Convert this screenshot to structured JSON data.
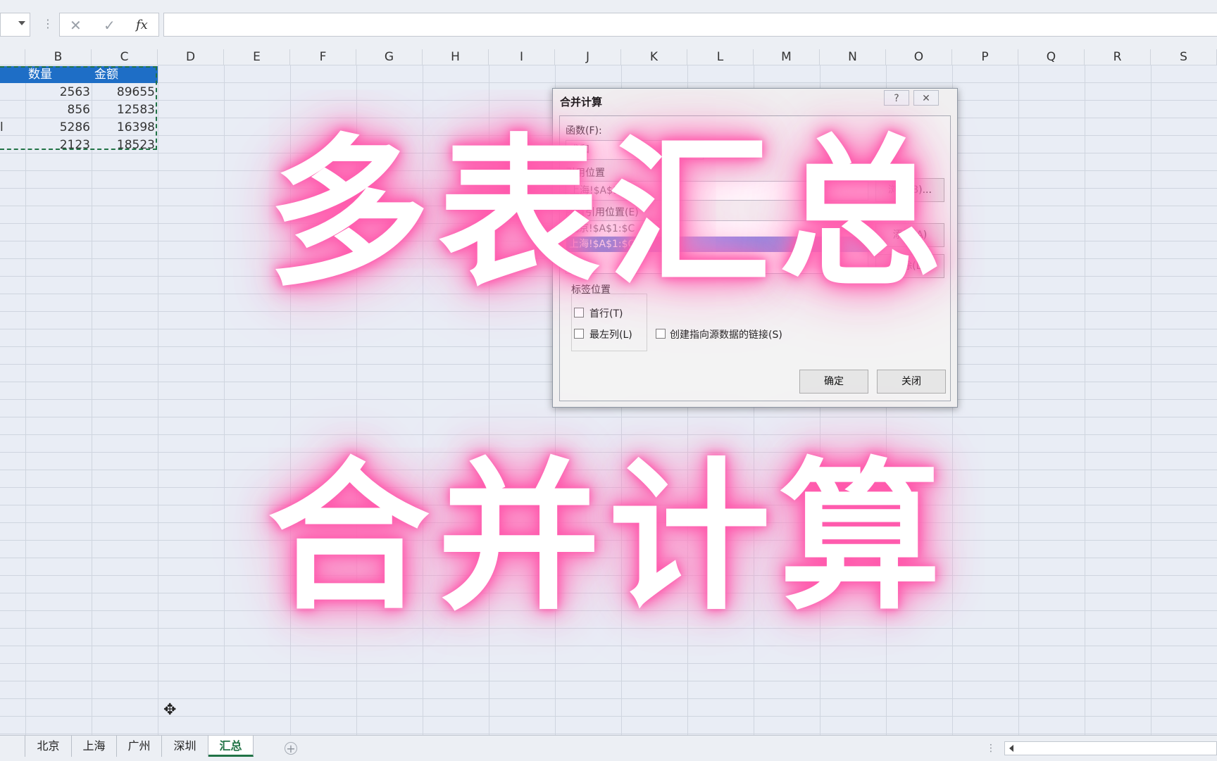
{
  "formula_bar": {
    "cancel_icon": "✕",
    "confirm_icon": "✓",
    "fx_label": "fx"
  },
  "columns": [
    "B",
    "C",
    "D",
    "E",
    "F",
    "G",
    "H",
    "I",
    "J",
    "K",
    "L",
    "M",
    "N",
    "O",
    "P",
    "Q",
    "R",
    "S"
  ],
  "table": {
    "headers": [
      "数量",
      "金额"
    ],
    "rows": [
      {
        "prefix": "",
        "qty": "2563",
        "amt": "89655"
      },
      {
        "prefix": "",
        "qty": "856",
        "amt": "12583"
      },
      {
        "prefix": "l",
        "qty": "5286",
        "amt": "16398"
      },
      {
        "prefix": "",
        "qty": "2123",
        "amt": "18523"
      }
    ]
  },
  "dialog": {
    "title": "合并计算",
    "help_icon": "?",
    "close_icon": "✕",
    "function_label": "函数(F):",
    "function_value": "求和",
    "ref_label": "引用位置",
    "ref_value": "上海!$A$1:$C",
    "browse_button": "浏览(B)...",
    "all_refs_label": "所有引用位置(E)",
    "all_refs": [
      "北京!$A$1:$C",
      "上海!$A$1:$C"
    ],
    "add_button": "添加(A)",
    "delete_button": "删除(D)",
    "label_position": "标签位置",
    "first_row": "首行(T)",
    "left_column": "最左列(L)",
    "link_source": "创建指向源数据的链接(S)",
    "ok_button": "确定",
    "close_button": "关闭"
  },
  "overlay": {
    "line1": "多表汇总",
    "line2": "合并计算"
  },
  "sheets": {
    "tabs": [
      "北京",
      "上海",
      "广州",
      "深圳",
      "汇总"
    ],
    "active": "汇总",
    "add_icon": "+"
  }
}
